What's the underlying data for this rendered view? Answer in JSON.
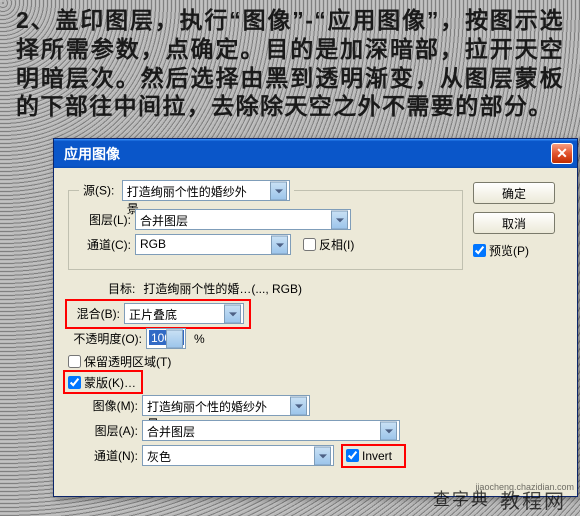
{
  "instruction": "2、盖印图层，执行“图像”-“应用图像”，按图示选择所需参数，点确定。目的是加深暗部，拉开天空明暗层次。然后选择由黑到透明渐变，从图层蒙板的下部往中间拉，去除除天空之外不需要的部分。",
  "dialog": {
    "title": "应用图像",
    "source_legend": "源(S):",
    "source_select": "打造绚丽个性的婚纱外景…",
    "layer_label": "图层(L):",
    "layer_value": "合并图层",
    "channel_label": "通道(C):",
    "channel_value": "RGB",
    "invert_label": "反相(I)",
    "target_label": "目标:",
    "target_value": "打造绚丽个性的婚…(..., RGB)",
    "blend_label": "混合(B):",
    "blend_value": "正片叠底",
    "opacity_label": "不透明度(O):",
    "opacity_value": "100",
    "opacity_unit": "%",
    "preserve_label": "保留透明区域(T)",
    "mask_label": "蒙版(K)…",
    "image_label": "图像(M):",
    "image_value": "打造绚丽个性的婚纱外景…",
    "mask_layer_label": "图层(A):",
    "mask_layer_value": "合并图层",
    "mask_channel_label": "通道(N):",
    "mask_channel_value": "灰色",
    "invert2_label": "Invert",
    "ok_label": "确定",
    "cancel_label": "取消",
    "preview_label": "预览(P)"
  },
  "watermarks": {
    "w1": "查字典",
    "w2": "教程网",
    "w3": "jiaocheng.chazidian.com"
  }
}
